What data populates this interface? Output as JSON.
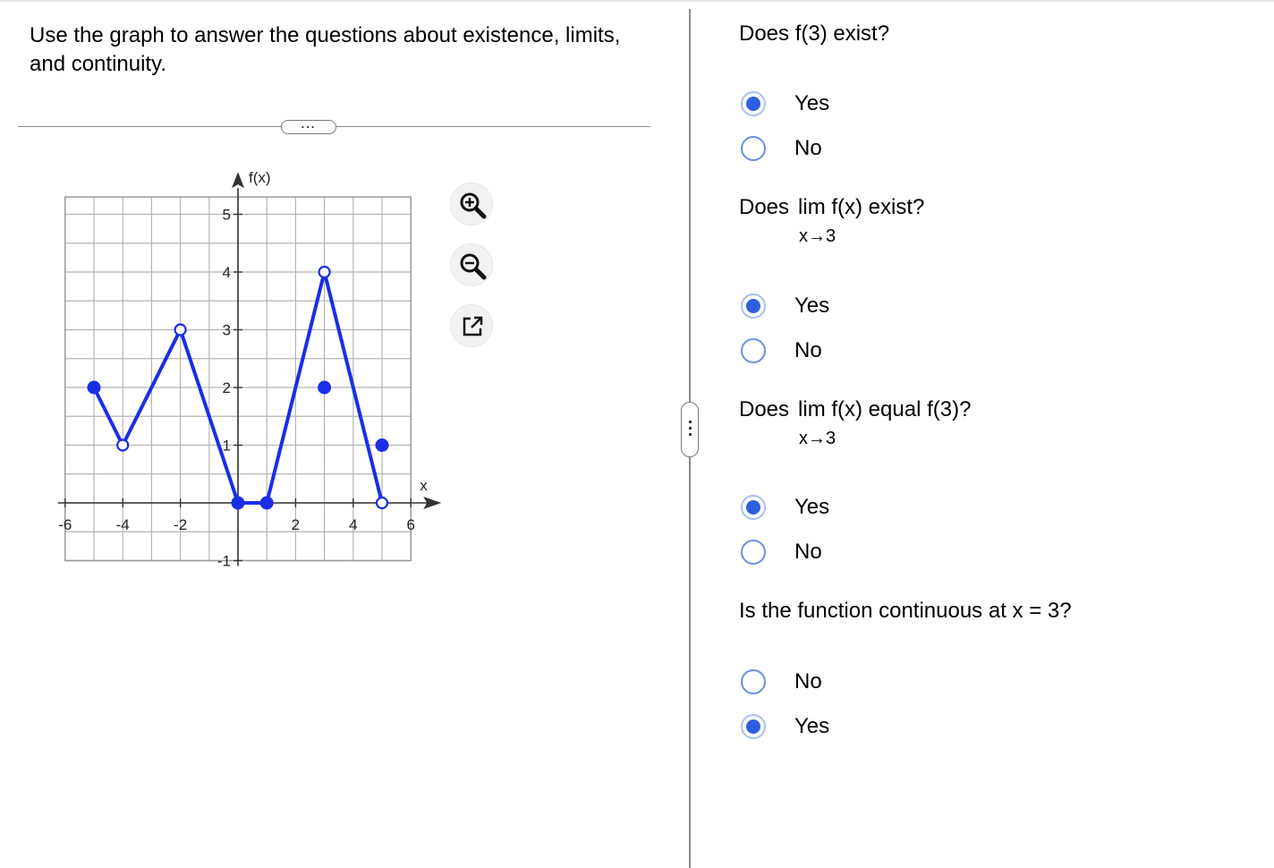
{
  "instructions": "Use the graph to answer the questions about existence, limits, and continuity.",
  "more_button_label": "...",
  "graph": {
    "y_axis_label": "f(x)",
    "x_axis_label": "x",
    "x_tick_labels": [
      "-6",
      "-4",
      "-2",
      "2",
      "4",
      "6"
    ],
    "y_tick_labels": [
      "5",
      "4",
      "3",
      "2",
      "1",
      "-1"
    ],
    "line_color": "#1a2ee8",
    "tools": [
      "zoom-in-icon",
      "zoom-out-icon",
      "popout-icon"
    ]
  },
  "chart_data": {
    "type": "line",
    "xlim": [
      -6,
      6
    ],
    "ylim": [
      -1,
      5
    ],
    "grid": true,
    "segments": [
      [
        [
          -5,
          2
        ],
        [
          -4,
          1
        ],
        [
          -2,
          3
        ],
        [
          0,
          0
        ],
        [
          1,
          0
        ],
        [
          3,
          4
        ],
        [
          5,
          0
        ]
      ]
    ],
    "closed_points": [
      [
        -5,
        2
      ],
      [
        0,
        0
      ],
      [
        1,
        0
      ],
      [
        3,
        2
      ],
      [
        5,
        1
      ]
    ],
    "open_points": [
      [
        -4,
        1
      ],
      [
        -2,
        3
      ],
      [
        3,
        4
      ],
      [
        5,
        0
      ]
    ]
  },
  "questions": [
    {
      "text": "Does f(3) exist?",
      "options": [
        {
          "label": "Yes",
          "checked": true
        },
        {
          "label": "No",
          "checked": false
        }
      ]
    },
    {
      "text_pre": "Does",
      "text_post": "lim f(x) exist?",
      "sub": "x→3",
      "options": [
        {
          "label": "Yes",
          "checked": true
        },
        {
          "label": "No",
          "checked": false
        }
      ]
    },
    {
      "text_pre": "Does",
      "text_post": "lim f(x) equal f(3)?",
      "sub": "x→3",
      "options": [
        {
          "label": "Yes",
          "checked": true
        },
        {
          "label": "No",
          "checked": false
        }
      ]
    },
    {
      "text": "Is the function continuous at x = 3?",
      "options": [
        {
          "label": "No",
          "checked": false
        },
        {
          "label": "Yes",
          "checked": true
        }
      ]
    }
  ]
}
